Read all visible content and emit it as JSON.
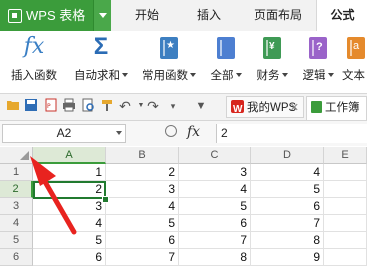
{
  "app": {
    "title": "WPS 表格"
  },
  "menu": {
    "tabs": [
      "开始",
      "插入",
      "页面布局",
      "公式"
    ],
    "active_tab": "公式"
  },
  "ribbon": {
    "buttons": [
      {
        "label": "插入函数",
        "icon": "fx-icon"
      },
      {
        "label": "自动求和",
        "icon": "sigma-icon",
        "has_dropdown": true
      },
      {
        "label": "常用函数",
        "icon": "star-book-icon",
        "has_dropdown": true
      },
      {
        "label": "全部",
        "icon": "book-icon",
        "has_dropdown": true
      },
      {
        "label": "财务",
        "icon": "money-book-icon",
        "has_dropdown": true
      },
      {
        "label": "逻辑",
        "icon": "question-book-icon",
        "has_dropdown": true
      },
      {
        "label": "文本",
        "icon": "text-book-icon"
      }
    ]
  },
  "doc_tabs": [
    {
      "label": "我的WPS",
      "icon": "wps-logo-icon",
      "closable": true
    },
    {
      "label": "工作簿",
      "icon": "sheet-icon"
    }
  ],
  "formula_bar": {
    "name_box": "A2",
    "fx_label": "fx",
    "value": "2"
  },
  "grid": {
    "columns": [
      "A",
      "B",
      "C",
      "D",
      "E"
    ],
    "selected_column": "A",
    "selected_row": 2,
    "rows": [
      {
        "n": "1",
        "cells": [
          "1",
          "2",
          "3",
          "4"
        ]
      },
      {
        "n": "2",
        "cells": [
          "2",
          "3",
          "4",
          "5"
        ]
      },
      {
        "n": "3",
        "cells": [
          "3",
          "4",
          "5",
          "6"
        ]
      },
      {
        "n": "4",
        "cells": [
          "4",
          "5",
          "6",
          "7"
        ]
      },
      {
        "n": "5",
        "cells": [
          "5",
          "6",
          "7",
          "8"
        ]
      },
      {
        "n": "6",
        "cells": [
          "6",
          "7",
          "8",
          "9"
        ]
      }
    ]
  },
  "colors": {
    "accent": "#3b9c3b",
    "annotation_arrow": "#e8231f"
  }
}
